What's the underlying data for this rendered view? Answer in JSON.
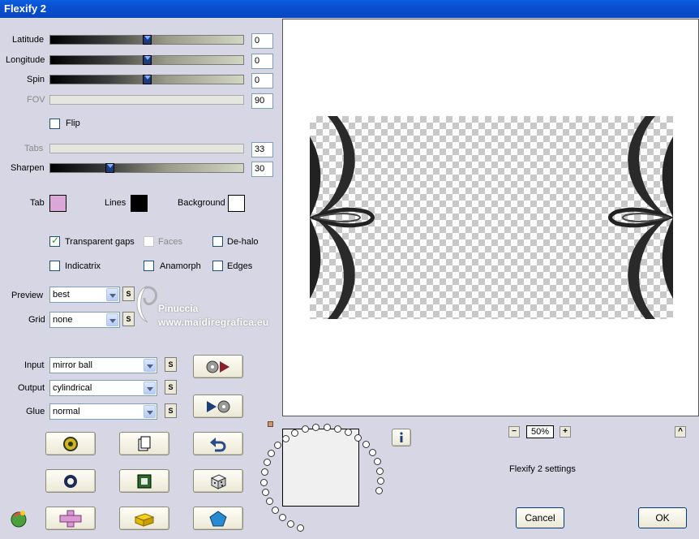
{
  "window": {
    "title": "Flexify 2"
  },
  "sliders": {
    "latitude": {
      "label": "Latitude",
      "value": "0",
      "level": 0.5
    },
    "longitude": {
      "label": "Longitude",
      "value": "0",
      "level": 0.5
    },
    "spin": {
      "label": "Spin",
      "value": "0",
      "level": 0.5
    },
    "fov": {
      "label": "FOV",
      "value": "90",
      "disabled": true
    },
    "tabs": {
      "label": "Tabs",
      "value": "33",
      "disabled": true
    },
    "sharpen": {
      "label": "Sharpen",
      "value": "30",
      "level": 0.3
    }
  },
  "flip": {
    "label": "Flip",
    "checked": false
  },
  "colors": {
    "tab": {
      "label": "Tab",
      "value": "#dba6d8"
    },
    "lines": {
      "label": "Lines",
      "value": "#000000"
    },
    "background": {
      "label": "Background",
      "value": "#ffffff"
    }
  },
  "options": {
    "transparent_gaps": {
      "label": "Transparent gaps",
      "checked": true
    },
    "faces": {
      "label": "Faces",
      "checked": false,
      "disabled": true
    },
    "de_halo": {
      "label": "De-halo",
      "checked": false
    },
    "indicatrix": {
      "label": "Indicatrix",
      "checked": false
    },
    "anamorph": {
      "label": "Anamorph",
      "checked": false
    },
    "edges": {
      "label": "Edges",
      "checked": false
    }
  },
  "preview_select": {
    "label": "Preview",
    "value": "best"
  },
  "grid_select": {
    "label": "Grid",
    "value": "none"
  },
  "input_select": {
    "label": "Input",
    "value": "mirror ball"
  },
  "output_select": {
    "label": "Output",
    "value": "cylindrical"
  },
  "glue_select": {
    "label": "Glue",
    "value": "normal"
  },
  "s_button": "S",
  "watermark": {
    "line1": "Pinuccia",
    "line2": "www.maidiregrafica.eu"
  },
  "zoom": {
    "value": "50%",
    "minus": "−",
    "plus": "+",
    "collapse": "^"
  },
  "status": "Flexify 2 settings",
  "buttons": {
    "cancel": "Cancel",
    "ok": "OK",
    "info": "i"
  }
}
